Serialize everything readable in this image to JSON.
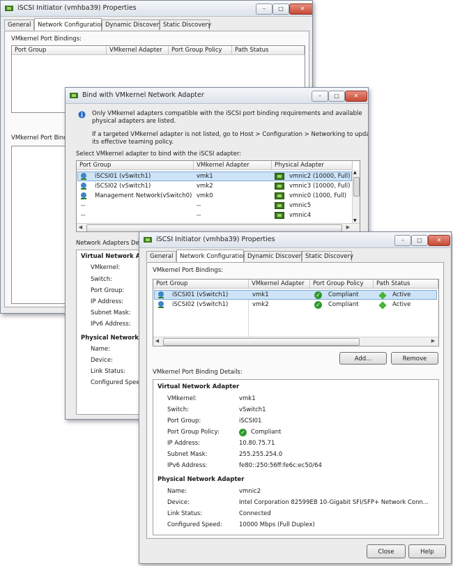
{
  "back_window": {
    "title": "iSCSI Initiator (vmhba39) Properties",
    "tabs": [
      "General",
      "Network Configuration",
      "Dynamic Discovery",
      "Static Discovery"
    ],
    "bindings_label": "VMkernel Port Bindings:",
    "columns": [
      "Port Group",
      "VMkernel Adapter",
      "Port Group Policy",
      "Path Status"
    ],
    "details_label": "VMkernel Port Bindi"
  },
  "bind_dialog": {
    "title": "Bind with VMkernel Network Adapter",
    "info_text_1": "Only VMkernel adapters compatible with the iSCSI port binding requirements and available",
    "info_text_1b": "physical adapters are listed.",
    "info_text_2": "If a targeted VMkernel adapter is not listed, go to Host > Configuration > Networking to update",
    "info_text_2b": "its effective teaming policy.",
    "select_label": "Select VMkernel adapter to bind with the iSCSI adapter:",
    "columns": [
      "Port Group",
      "VMkernel Adapter",
      "Physical Adapter"
    ],
    "rows": [
      {
        "port_group": "iSCSI01 (vSwitch1)",
        "vmk": "vmk1",
        "physical": "vmnic2 (10000, Full)"
      },
      {
        "port_group": "iSCSI02 (vSwitch1)",
        "vmk": "vmk2",
        "physical": "vmnic3 (10000, Full)"
      },
      {
        "port_group": "Management Network(vSwitch0)",
        "vmk": "vmk0",
        "physical": "vmnic0 (1000, Full)"
      },
      {
        "port_group": "--",
        "vmk": "--",
        "physical": "vmnic5"
      },
      {
        "port_group": "--",
        "vmk": "--",
        "physical": "vmnic4"
      }
    ],
    "details_label": "Network Adapters Deta",
    "virtual_heading": "Virtual Network Ad",
    "virtual_keys": [
      "VMkernel:",
      "Switch:",
      "Port Group:",
      "IP Address:",
      "Subnet Mask:",
      "IPv6 Address:"
    ],
    "physical_heading": "Physical Network A",
    "physical_keys": [
      "Name:",
      "Device:",
      "Link Status:",
      "Configured Speed"
    ]
  },
  "front_window": {
    "title": "iSCSI Initiator (vmhba39) Properties",
    "tabs": [
      "General",
      "Network Configuration",
      "Dynamic Discovery",
      "Static Discovery"
    ],
    "bindings_label": "VMkernel Port Bindings:",
    "columns": [
      "Port Group",
      "VMkernel Adapter",
      "Port Group Policy",
      "Path Status"
    ],
    "rows": [
      {
        "port_group": "iSCSI01 (vSwitch1)",
        "vmk": "vmk1",
        "policy": "Compliant",
        "status": "Active"
      },
      {
        "port_group": "iSCSI02 (vSwitch1)",
        "vmk": "vmk2",
        "policy": "Compliant",
        "status": "Active"
      }
    ],
    "add_button": "Add...",
    "remove_button": "Remove",
    "details_label": "VMkernel Port Binding Details:",
    "virtual_heading": "Virtual Network Adapter",
    "virtual": [
      {
        "k": "VMkernel:",
        "v": "vmk1"
      },
      {
        "k": "Switch:",
        "v": "vSwitch1"
      },
      {
        "k": "Port Group:",
        "v": "iSCSI01"
      },
      {
        "k": "Port Group Policy:",
        "v": "Compliant"
      },
      {
        "k": "IP Address:",
        "v": "10.80.75.71"
      },
      {
        "k": "Subnet Mask:",
        "v": "255.255.254.0"
      },
      {
        "k": "IPv6 Address:",
        "v": "fe80::250:56ff:fe6c:ec50/64"
      }
    ],
    "physical_heading": "Physical Network Adapter",
    "physical": [
      {
        "k": "Name:",
        "v": "vmnic2"
      },
      {
        "k": "Device:",
        "v": "Intel Corporation 82599EB 10-Gigabit SFI/SFP+ Network Conn..."
      },
      {
        "k": "Link Status:",
        "v": "Connected"
      },
      {
        "k": "Configured Speed:",
        "v": "10000 Mbps (Full Duplex)"
      }
    ],
    "close_button": "Close",
    "help_button": "Help"
  },
  "colors": {
    "selection": "#cde3f7",
    "compliant": "#2f9a2f",
    "active": "#49b33a",
    "nic": "#3d7a1f"
  },
  "icons": [
    "iscsi-window-icon",
    "vmkernel-adapter-icon",
    "physical-nic-icon",
    "compliant-check-icon",
    "active-diamond-icon"
  ]
}
